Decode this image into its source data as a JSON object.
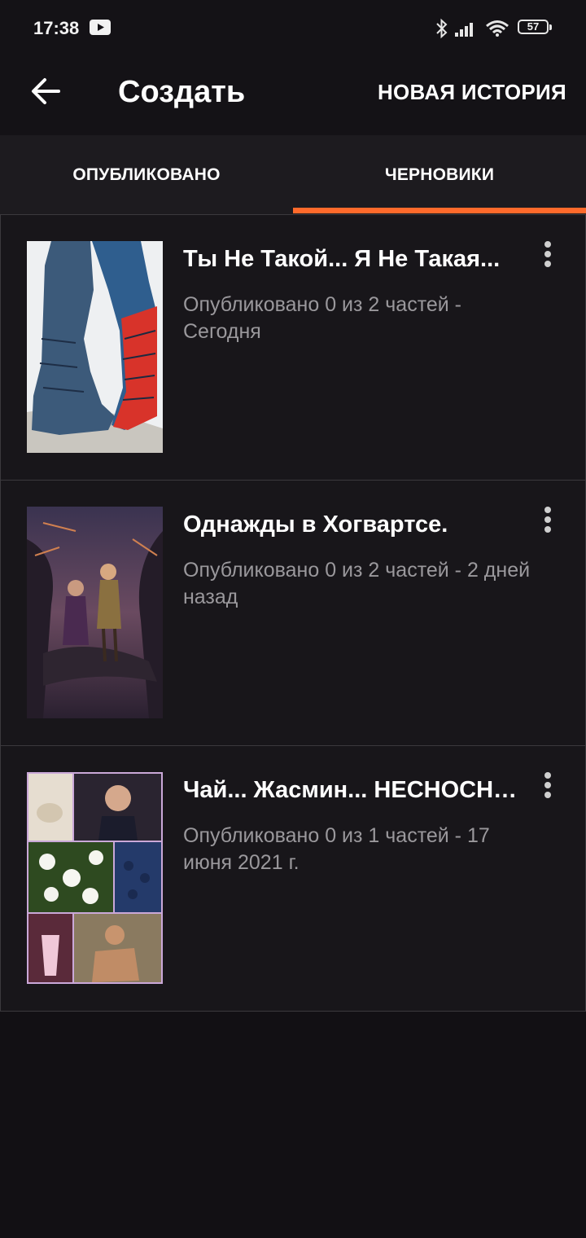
{
  "status_bar": {
    "time": "17:38",
    "battery_level": "57"
  },
  "toolbar": {
    "title": "Создать",
    "new_story_label": "НОВАЯ ИСТОРИЯ"
  },
  "tabs": [
    {
      "label": "ОПУБЛИКОВАНО",
      "selected": false
    },
    {
      "label": "ЧЕРНОВИКИ",
      "selected": true
    }
  ],
  "accent_color": "#ff6a2b",
  "stories": [
    {
      "title": "Ты Не Такой... Я Не Такая...",
      "meta": "Опубликовано 0 из 2 частей - Сегодня"
    },
    {
      "title": "Однажды в Хогвартсе.",
      "meta": "Опубликовано 0 из 2 частей - 2 дней назад"
    },
    {
      "title": "Чай... Жасмин... НЕСНОСНЫЙ...",
      "meta": "Опубликовано 0 из 1 частей - 17 июня 2021 г."
    }
  ]
}
